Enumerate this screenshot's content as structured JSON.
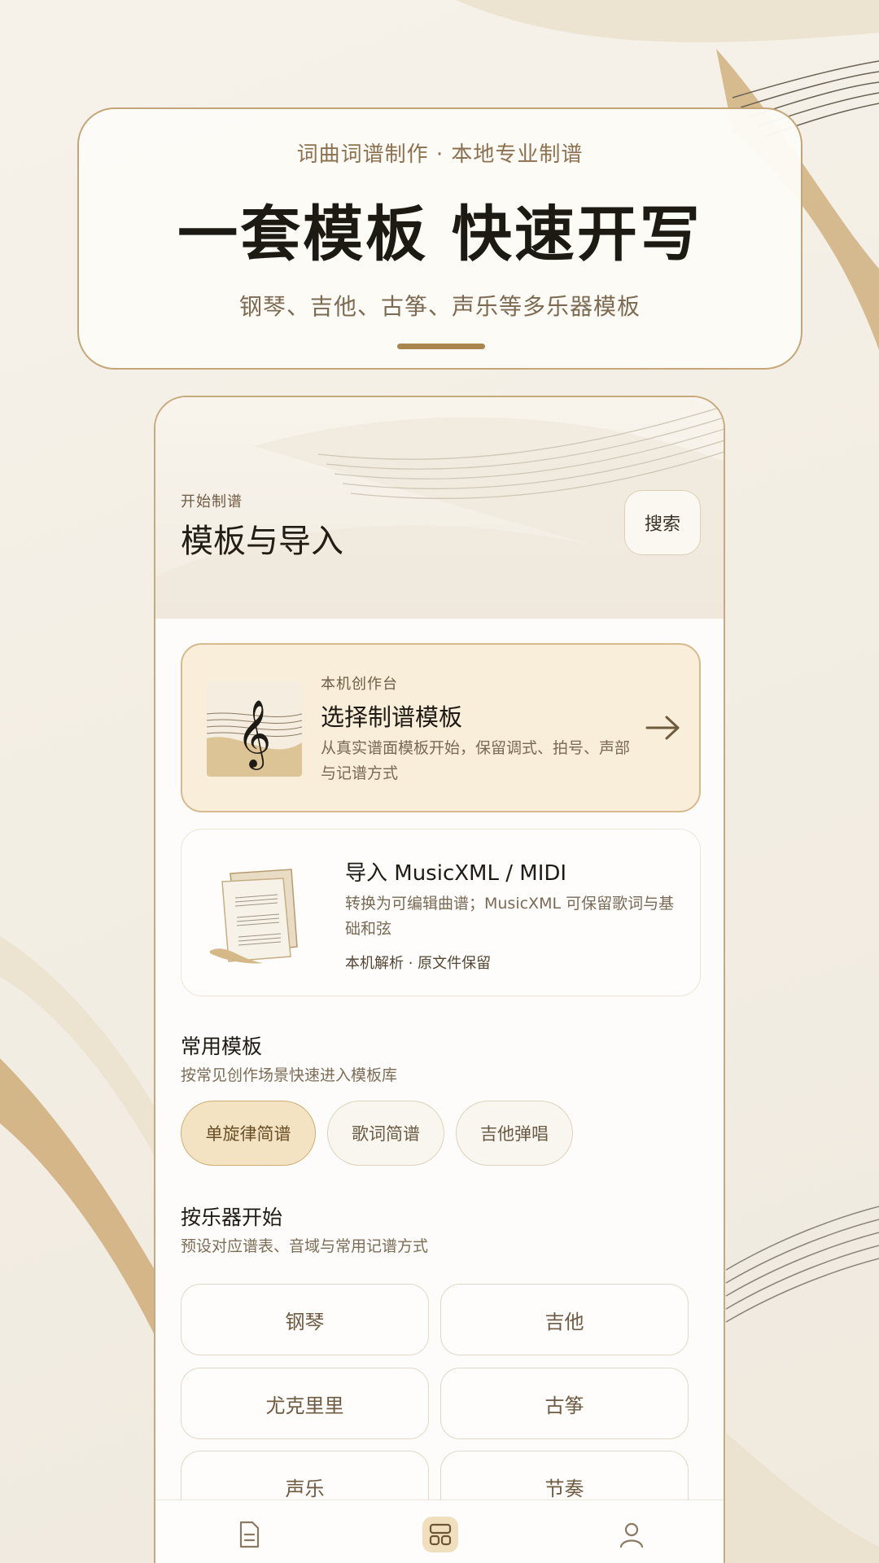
{
  "promo": {
    "eyebrow": "词曲词谱制作 · 本地专业制谱",
    "title": "一套模板 快速开写",
    "subtitle": "钢琴、吉他、古筝、声乐等多乐器模板"
  },
  "header": {
    "eyebrow": "开始制谱",
    "title": "模板与导入",
    "search_label": "搜索"
  },
  "select_card": {
    "eyebrow": "本机创作台",
    "title": "选择制谱模板",
    "description": "从真实谱面模板开始，保留调式、拍号、声部与记谱方式"
  },
  "import_card": {
    "title": "导入 MusicXML / MIDI",
    "description": "转换为可编辑曲谱；MusicXML 可保留歌词与基础和弦",
    "meta": "本机解析 · 原文件保留"
  },
  "common_templates": {
    "title": "常用模板",
    "subtitle": "按常见创作场景快速进入模板库",
    "chips": [
      "单旋律简谱",
      "歌词简谱",
      "吉他弹唱"
    ]
  },
  "instruments": {
    "title": "按乐器开始",
    "subtitle": "预设对应谱表、音域与常用记谱方式",
    "items": [
      "钢琴",
      "吉他",
      "尤克里里",
      "古筝",
      "声乐",
      "节奏"
    ]
  },
  "tabbar": {
    "items": [
      "作品",
      "模板",
      "我的"
    ]
  },
  "colors": {
    "accent": "#a9854f",
    "card_highlight": "#f8eed9",
    "chip_active": "#f3e3c2"
  },
  "icons": [
    "treble-clef-icon",
    "sheet-music-icon",
    "arrow-right-icon",
    "document-icon",
    "template-grid-icon",
    "user-icon"
  ]
}
